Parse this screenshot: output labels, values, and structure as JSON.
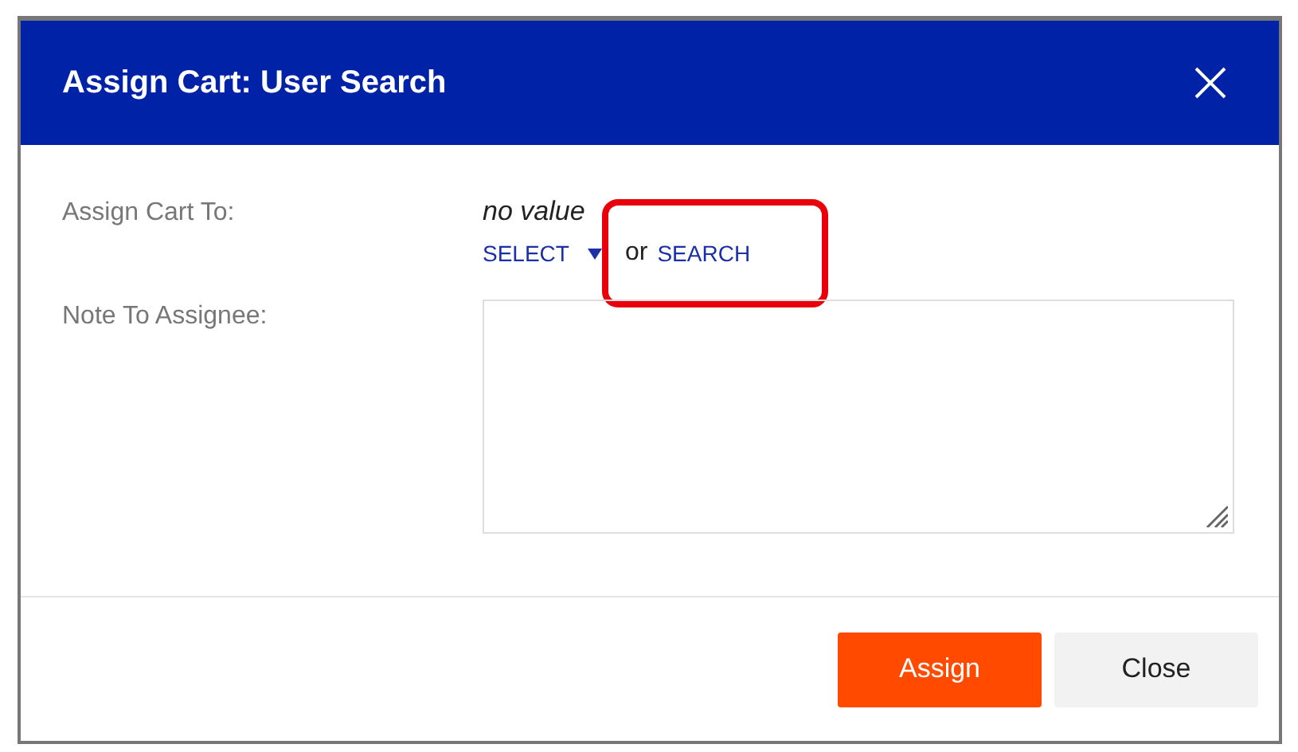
{
  "dialog": {
    "title": "Assign Cart: User Search"
  },
  "fields": [
    {
      "kind": "picker",
      "label": "Assign Cart To:",
      "value": "no value",
      "select_link": "SELECT",
      "separator": "or",
      "search_link": "SEARCH",
      "search_highlighted": true
    },
    {
      "kind": "textarea",
      "label": "Note To Assignee:"
    }
  ],
  "buttons": [
    {
      "label": "Assign",
      "kind": "primary"
    },
    {
      "label": "Close",
      "kind": "secondary"
    }
  ]
}
